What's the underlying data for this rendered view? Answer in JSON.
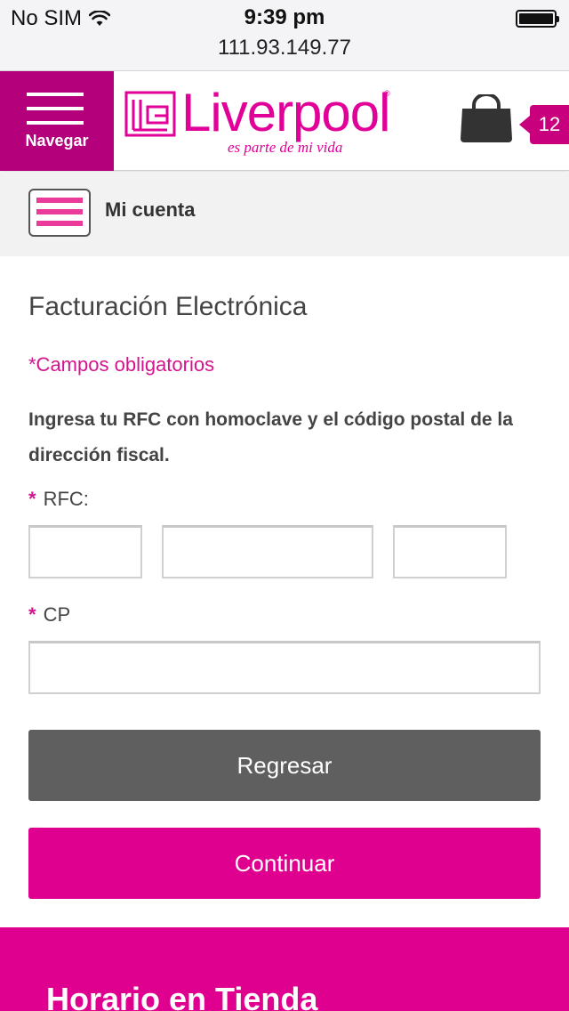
{
  "status_bar": {
    "carrier": "No SIM",
    "time": "9:39 pm",
    "url": "111.93.149.77"
  },
  "header": {
    "nav_label": "Navegar",
    "logo_text": "Liverpool",
    "logo_tagline": "es parte de mi vida",
    "cart_count": "12"
  },
  "account": {
    "label": "Mi cuenta"
  },
  "form": {
    "title": "Facturación Electrónica",
    "required_note": "*Campos obligatorios",
    "instructions": "Ingresa tu RFC con homoclave y el código postal de la dirección fiscal.",
    "rfc_label": "RFC:",
    "rfc_values": [
      "",
      "",
      ""
    ],
    "cp_label": "CP",
    "cp_value": "",
    "required_mark": "*"
  },
  "buttons": {
    "back_label": "Regresar",
    "continue_label": "Continuar"
  },
  "footer": {
    "title": "Horario en Tienda"
  },
  "colors": {
    "brand_pink": "#e0008f",
    "nav_magenta": "#b5007c",
    "back_button_gray": "#5f5f5f"
  }
}
